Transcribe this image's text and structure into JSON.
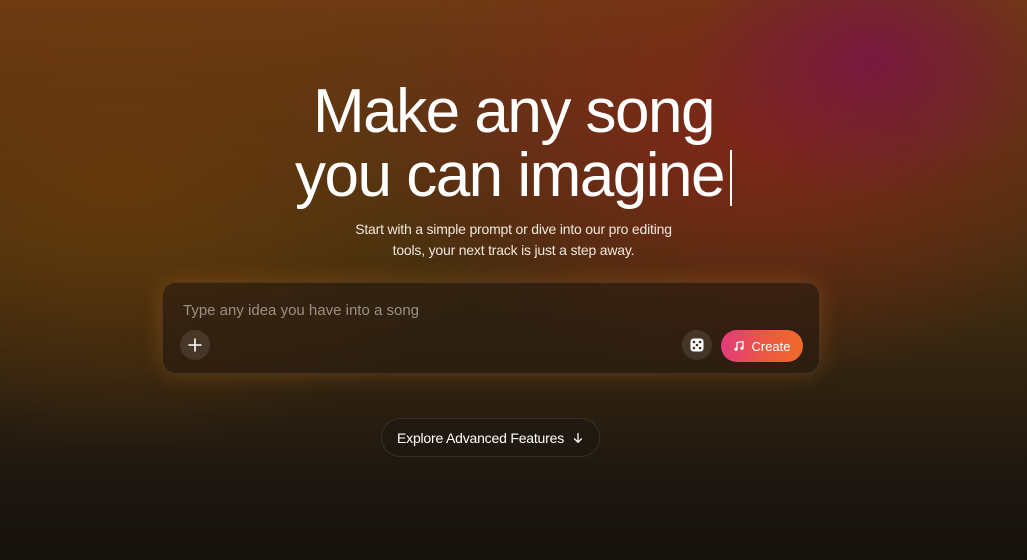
{
  "hero": {
    "headline_line1": "Make any song",
    "headline_line2": "you can imagine",
    "subtitle_line1": "Start with a simple prompt or dive into our pro editing",
    "subtitle_line2": "tools, your next track is just a step away."
  },
  "prompt": {
    "placeholder": "Type any idea you have into a song",
    "value": "",
    "add_icon": "plus-icon",
    "dice_icon": "dice-icon",
    "create_icon": "music-note-icon",
    "create_label": "Create"
  },
  "explore": {
    "label": "Explore Advanced Features",
    "icon": "arrow-down-icon"
  },
  "colors": {
    "create_gradient_start": "#e23c7c",
    "create_gradient_end": "#f06b2a"
  }
}
